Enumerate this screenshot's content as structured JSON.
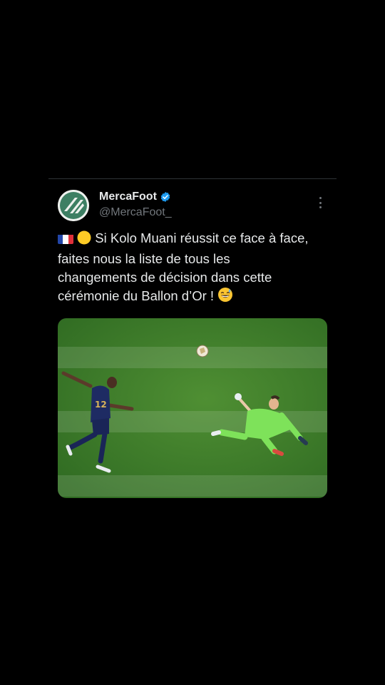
{
  "tweet": {
    "author": {
      "display_name": "MercaFoot",
      "handle": "@MercaFoot_",
      "verified": true,
      "avatar_icon": "mercafoot-logo-icon"
    },
    "text": {
      "emojis_leading": [
        "france-flag-emoji",
        "yellow-circle-emoji"
      ],
      "body": "Si Kolo Muani réussit ce face à face, faites nous la liste de tous les changements de décision dans cette cérémonie du Ballon d’Or !",
      "emoji_trailing": "grinning-sweat-emoji"
    },
    "media": {
      "type": "photo",
      "description_icon": "football-match-photo"
    }
  },
  "colors": {
    "background": "#000000",
    "text": "#e7e9ea",
    "muted": "#71767b",
    "verified": "#1d9bf0",
    "divider": "#2f3336"
  }
}
